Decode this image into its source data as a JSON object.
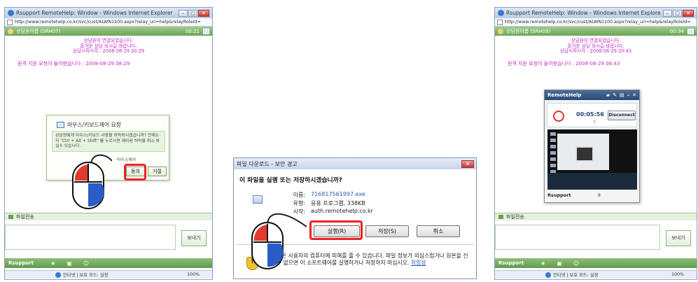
{
  "left_window": {
    "title": "Rsupport RemoteHelp: Window - Windows Internet Explorer",
    "url": "http://www.remotehelp.co.kr/svc/cust/ALWN1100.aspx?relay_uri=help&relayRoleId=",
    "session": "상담원이름 (SRH07)",
    "time": "00:21",
    "messages": [
      "상담원이 연결되었습니다.",
      "즐거운 상담 되시길 바랍니다.",
      "상담시작시각 : 2008-08-29 20:29"
    ],
    "request": "원격 지원 요청이 들어왔습니다 : 2008-08-29 08:29",
    "permission": {
      "title": "마우스/키보드제어 요청",
      "body": "상담원에게 마우스/키보드 사용을 허락하시겠습니까? 언제든지 \"Ctrl + Alt + Shift\" 를 누르시면 제어권 허락을 취소 하실수 있습니다.",
      "note": "마우스제어",
      "agree": "동의",
      "reject": "거절"
    },
    "file_transfer": "파일전송",
    "send": "보내기",
    "brand": "Rsupport",
    "status_zone": "인터넷 | 보호 모드: 설정",
    "zoom": "100%"
  },
  "dialog": {
    "title": "파일 다운로드 - 보안 경고",
    "question": "이 파일을 실행 또는 저장하시겠습니까?",
    "name_label": "이름:",
    "name": "716817561997.exe",
    "type_label": "유형:",
    "type": "응용 프로그램, 338KB",
    "from_label": "시작:",
    "from": "auth.remotehelp.co.kr",
    "run": "실행(R)",
    "save": "저장(S)",
    "cancel": "취소",
    "warning": "이 파일은 사용자의 컴퓨터에 피해를 줄 수 있습니다. 파일 정보가 의심스럽거나 원본을 신뢰할 수 없으면 이 소프트웨어를 실행하거나 저장하지 마십시오.",
    "risk_link": "위험성"
  },
  "right_window": {
    "title": "Rsupport RemoteHelp: Window - Windows Internet Explorer",
    "url": "http://www.remotehelp.co.kr/svc/cust/ALWN1100.aspx?relay_uri=help&relayRoleId=",
    "session": "상담원이름 (SRH09)",
    "time": "00:34",
    "messages": [
      "상담원이 연결되었습니다.",
      "즐거운 상담 되시길 바랍니다.",
      "상담시작시각 : 2008-08-29 20:43"
    ],
    "request": "원격 지원 요청이 들어왔습니다 : 2008-08-29 08:43",
    "file_transfer": "파일전송",
    "send": "보내기",
    "brand": "Rsupport",
    "status_zone": "인터넷 | 보호 모드: 설정",
    "zoom": "100%",
    "remotehelp": {
      "title": "RemoteHelp",
      "timer": "00:05:56",
      "disconnect": "Disconnect",
      "footer": "Rsupport"
    }
  }
}
